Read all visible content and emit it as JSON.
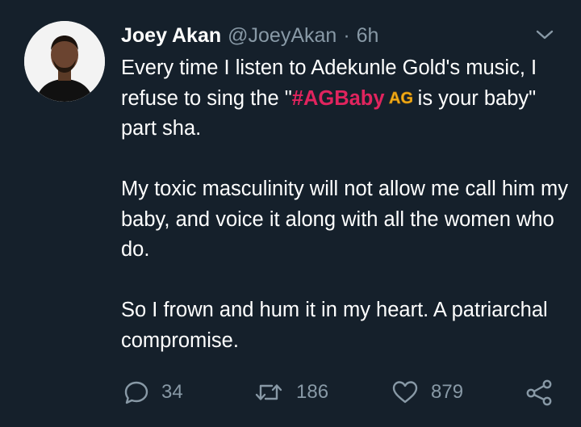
{
  "tweet": {
    "author_name": "Joey Akan",
    "author_handle": "@JoeyAkan",
    "separator": "·",
    "time": "6h",
    "text": {
      "p1_before": "Every time I listen to Adekunle Gold's music, I refuse to sing the \"",
      "hashtag": "#AGBaby",
      "hashtag_emoji": "AG",
      "p1_after": " is your baby\" part sha.",
      "p2": "My toxic masculinity will not allow me call him my baby, and voice it along with all the women who do.",
      "p3": "So I frown and hum it in my heart. A patriarchal compromise."
    },
    "actions": {
      "reply_count": "34",
      "retweet_count": "186",
      "like_count": "879"
    }
  },
  "colors": {
    "background": "#15202b",
    "text": "#ffffff",
    "secondary": "#8899a6",
    "hashtag": "#e0245e",
    "ag_emoji": "#f5b01a"
  },
  "icons": {
    "menu": "chevron-down-icon",
    "reply": "reply-icon",
    "retweet": "retweet-icon",
    "like": "heart-icon",
    "share": "share-icon"
  }
}
